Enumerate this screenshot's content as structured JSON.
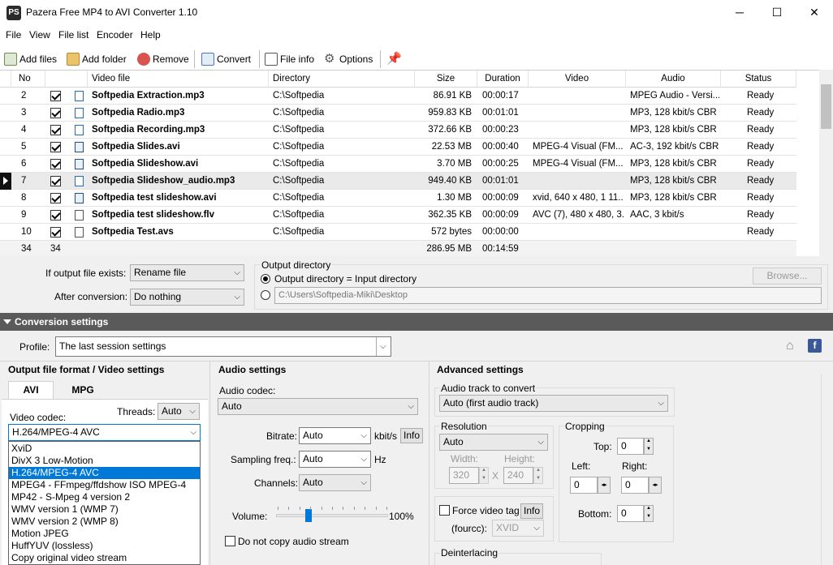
{
  "window": {
    "title": "Pazera Free MP4 to AVI Converter 1.10",
    "icon_text": "PS"
  },
  "menu": [
    "File",
    "View",
    "File list",
    "Encoder",
    "Help"
  ],
  "toolbar": {
    "add_files": "Add files",
    "add_folder": "Add folder",
    "remove": "Remove",
    "convert": "Convert",
    "file_info": "File info",
    "options": "Options"
  },
  "table": {
    "headers": [
      "No",
      "Video file",
      "Directory",
      "Size",
      "Duration",
      "Video",
      "Audio",
      "Status"
    ],
    "rows": [
      {
        "no": "2",
        "file": "Softpedia Extraction.mp3",
        "dir": "C:\\Softpedia",
        "size": "86.91 KB",
        "dur": "00:00:17",
        "video": "",
        "audio": "MPEG Audio - Versi...",
        "status": "Ready"
      },
      {
        "no": "3",
        "file": "Softpedia Radio.mp3",
        "dir": "C:\\Softpedia",
        "size": "959.83 KB",
        "dur": "00:01:01",
        "video": "",
        "audio": "MP3, 128 kbit/s  CBR",
        "status": "Ready"
      },
      {
        "no": "4",
        "file": "Softpedia Recording.mp3",
        "dir": "C:\\Softpedia",
        "size": "372.66 KB",
        "dur": "00:00:23",
        "video": "",
        "audio": "MP3, 128 kbit/s  CBR",
        "status": "Ready"
      },
      {
        "no": "5",
        "file": "Softpedia Slides.avi",
        "dir": "C:\\Softpedia",
        "size": "22.53 MB",
        "dur": "00:00:40",
        "video": "MPEG-4 Visual (FM...",
        "audio": "AC-3, 192 kbit/s  CBR",
        "status": "Ready"
      },
      {
        "no": "6",
        "file": "Softpedia Slideshow.avi",
        "dir": "C:\\Softpedia",
        "size": "3.70 MB",
        "dur": "00:00:25",
        "video": "MPEG-4 Visual (FM...",
        "audio": "MP3, 128 kbit/s  CBR",
        "status": "Ready"
      },
      {
        "no": "7",
        "file": "Softpedia Slideshow_audio.mp3",
        "dir": "C:\\Softpedia",
        "size": "949.40 KB",
        "dur": "00:01:01",
        "video": "",
        "audio": "MP3, 128 kbit/s  CBR",
        "status": "Ready"
      },
      {
        "no": "8",
        "file": "Softpedia test slideshow.avi",
        "dir": "C:\\Softpedia",
        "size": "1.30 MB",
        "dur": "00:00:09",
        "video": "xvid, 640 x 480, 1 11...",
        "audio": "MP3, 128 kbit/s  CBR",
        "status": "Ready"
      },
      {
        "no": "9",
        "file": "Softpedia test slideshow.flv",
        "dir": "C:\\Softpedia",
        "size": "362.35 KB",
        "dur": "00:00:09",
        "video": "AVC (7), 480 x 480, 3...",
        "audio": "AAC, 3 kbit/s",
        "status": "Ready"
      },
      {
        "no": "10",
        "file": "Softpedia Test.avs",
        "dir": "C:\\Softpedia",
        "size": "572 bytes",
        "dur": "00:00:00",
        "video": "",
        "audio": "",
        "status": "Ready"
      }
    ],
    "footer": {
      "count": "34",
      "checked": "34",
      "size": "286.95 MB",
      "dur": "00:14:59"
    }
  },
  "options": {
    "if_exists_label": "If output file exists:",
    "if_exists_value": "Rename file",
    "after_label": "After conversion:",
    "after_value": "Do nothing",
    "outdir_title": "Output directory",
    "outdir_input_label": "Output directory = Input directory",
    "outdir_path": "C:\\Users\\Softpedia-Miki\\Desktop",
    "browse": "Browse..."
  },
  "conversion": {
    "header": "Conversion settings",
    "profile_label": "Profile:",
    "profile_value": "The last session settings",
    "output_title": "Output file format / Video settings",
    "tab_avi": "AVI",
    "tab_mpg": "MPG",
    "video_codec_label": "Video codec:",
    "threads_label": "Threads:",
    "threads_value": "Auto",
    "codec_value": "H.264/MPEG-4 AVC",
    "codec_options": [
      "XviD",
      "DivX 3 Low-Motion",
      "H.264/MPEG-4 AVC",
      "MPEG4 - FFmpeg/ffdshow ISO MPEG-4",
      "MP42 - S-Mpeg 4 version 2",
      "WMV version 1 (WMP 7)",
      "WMV version 2 (WMP 8)",
      "Motion JPEG",
      "HuffYUV (lossless)",
      "Copy original video stream"
    ],
    "codec_highlight_index": 2,
    "audio_title": "Audio settings",
    "audio_codec_label": "Audio codec:",
    "audio_codec_value": "Auto",
    "bitrate_label": "Bitrate:",
    "bitrate_value": "Auto",
    "bitrate_unit": "kbit/s",
    "info": "Info",
    "sampling_label": "Sampling freq.:",
    "sampling_value": "Auto",
    "sampling_unit": "Hz",
    "channels_label": "Channels:",
    "channels_value": "Auto",
    "volume_label": "Volume:",
    "volume_value": "100%",
    "volume_level": 0.3,
    "no_copy_audio": "Do not copy audio stream",
    "advanced_title": "Advanced settings",
    "track_label": "Audio track to convert",
    "track_value": "Auto (first audio track)",
    "resolution_label": "Resolution",
    "resolution_value": "Auto",
    "width_label": "Width:",
    "height_label": "Height:",
    "width_value": "320",
    "height_value": "240",
    "x_sep": "X",
    "cropping_label": "Cropping",
    "top_label": "Top:",
    "left_label": "Left:",
    "right_label": "Right:",
    "bottom_label": "Bottom:",
    "crop_top": "0",
    "crop_left": "0",
    "crop_right": "0",
    "crop_bottom": "0",
    "force_tag_label": "Force video tag",
    "fourcc_label": "(fourcc):",
    "fourcc_value": "XVID",
    "deinterlacing_label": "Deinterlacing"
  },
  "colors": {
    "accent": "#0078d7",
    "header_bar": "#5a5a5a",
    "facebook": "#3b5998"
  }
}
